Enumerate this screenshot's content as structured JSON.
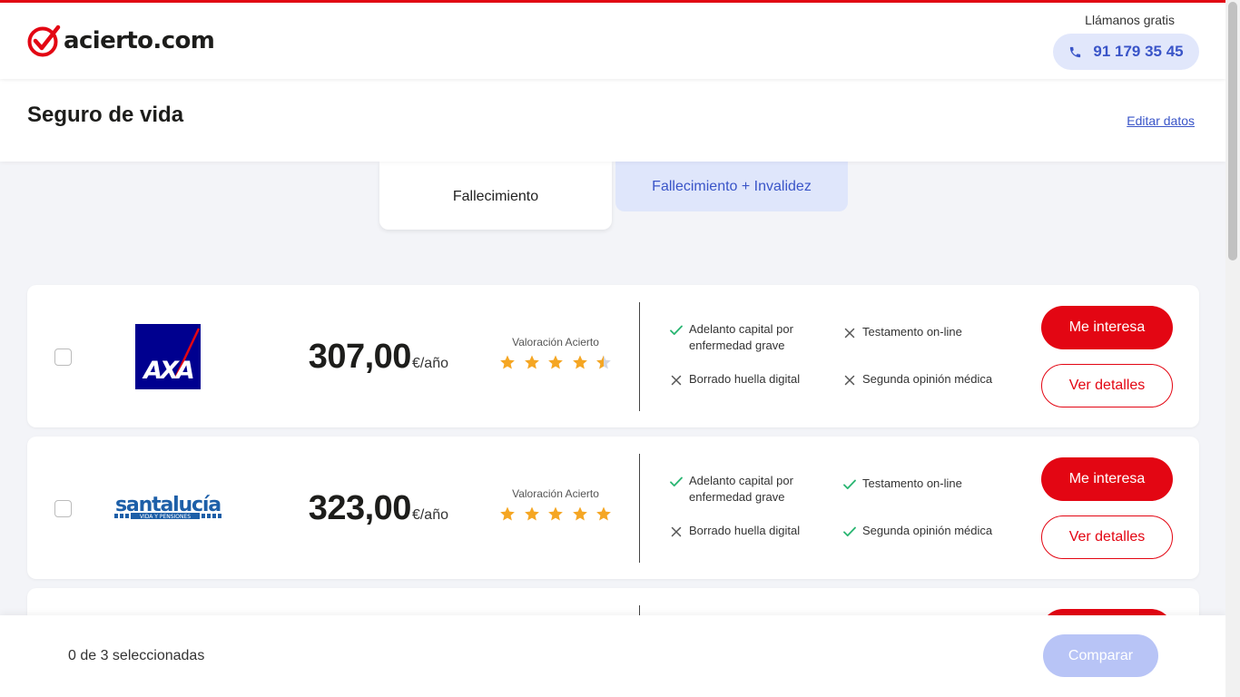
{
  "header": {
    "logo_text": "acierto.com",
    "call_label": "Llámanos gratis",
    "phone": "91 179 35 45"
  },
  "subheader": {
    "title": "Seguro de vida",
    "edit_link": "Editar datos"
  },
  "tabs": [
    {
      "label": "Fallecimiento",
      "active": true
    },
    {
      "label": "Fallecimiento + Invalidez",
      "active": false
    }
  ],
  "results": [
    {
      "insurer": "AXA",
      "price": "307,00",
      "price_unit": "€/año",
      "rating_label": "Valoración Acierto",
      "rating": 4.5,
      "features": [
        {
          "name": "Adelanto capital por enfermedad grave",
          "included": true
        },
        {
          "name": "Testamento on-line",
          "included": false
        },
        {
          "name": "Borrado huella digital",
          "included": false
        },
        {
          "name": "Segunda opinión médica",
          "included": false
        }
      ],
      "primary_button": "Me interesa",
      "secondary_button": "Ver detalles"
    },
    {
      "insurer": "santalucía",
      "insurer_sub": "VIDA Y PENSIONES",
      "price": "323,00",
      "price_unit": "€/año",
      "rating_label": "Valoración Acierto",
      "rating": 5,
      "features": [
        {
          "name": "Adelanto capital por enfermedad grave",
          "included": true
        },
        {
          "name": "Testamento on-line",
          "included": true
        },
        {
          "name": "Borrado huella digital",
          "included": false
        },
        {
          "name": "Segunda opinión médica",
          "included": true
        }
      ],
      "primary_button": "Me interesa",
      "secondary_button": "Ver detalles"
    }
  ],
  "footer": {
    "selected_text": "0 de 3 seleccionadas",
    "compare_button": "Comparar"
  },
  "colors": {
    "brand_red": "#e30613",
    "accent_blue": "#3a55c8",
    "star_gold": "#f5a623",
    "check_green": "#2bb673"
  },
  "icons": {
    "phone": "phone-icon",
    "included": "check-icon",
    "excluded": "cross-icon",
    "rating": "star-icon"
  }
}
